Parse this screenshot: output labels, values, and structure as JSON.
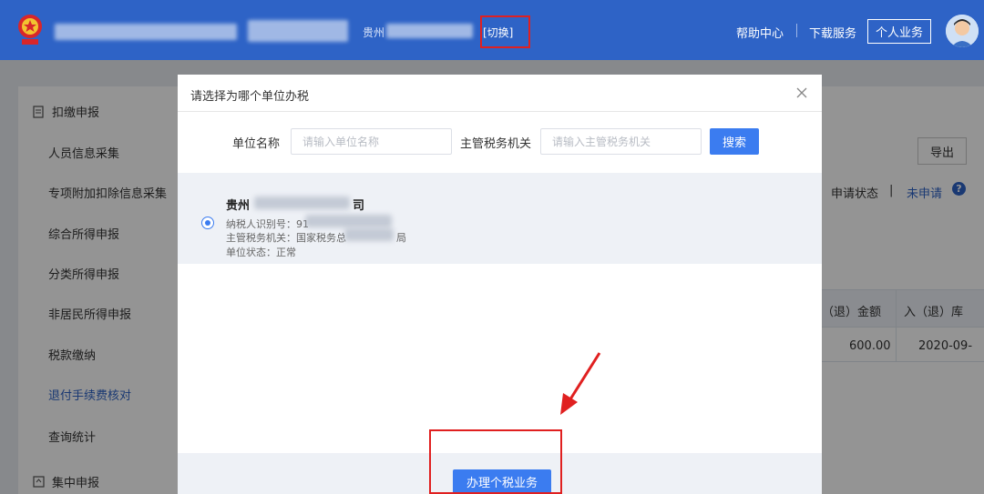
{
  "header": {
    "location_text": "贵州",
    "switch_label": "[切换]",
    "help_center": "帮助中心",
    "download_service": "下载服务",
    "personal_business": "个人业务",
    "brand_color": "#2e63c6"
  },
  "sidebar": {
    "section1": "扣缴申报",
    "items": [
      {
        "label": "人员信息采集"
      },
      {
        "label": "专项附加扣除信息采集"
      },
      {
        "label": "综合所得申报"
      },
      {
        "label": "分类所得申报"
      },
      {
        "label": "非居民所得申报"
      },
      {
        "label": "税款缴纳"
      },
      {
        "label": "退付手续费核对"
      },
      {
        "label": "查询统计"
      }
    ],
    "section2": "集中申报"
  },
  "main": {
    "export_label": "导出",
    "apply_status_label": "申请状态",
    "apply_sep": "|",
    "apply_status_value": "未申请",
    "help_mark": "?",
    "table": {
      "headers": [
        "（退）金额",
        "入（退）库"
      ],
      "row": [
        "600.00",
        "2020-09-"
      ]
    }
  },
  "modal": {
    "title": "请选择为哪个单位办税",
    "unit_name_label": "单位名称",
    "unit_name_placeholder": "请输入单位名称",
    "tax_office_label": "主管税务机关",
    "tax_office_placeholder": "请输入主管税务机关",
    "search_label": "搜索",
    "unit": {
      "name_prefix": "贵州",
      "name_suffix": "司",
      "taxpayer_id": "纳税人识别号：91",
      "tax_office_prefix": "主管税务机关：国家税务总",
      "tax_office_suffix": "局",
      "status": "单位状态：正常"
    },
    "handle_button": "办理个税业务",
    "accent_color": "#3b7cf0",
    "highlight_color": "#e02020"
  }
}
